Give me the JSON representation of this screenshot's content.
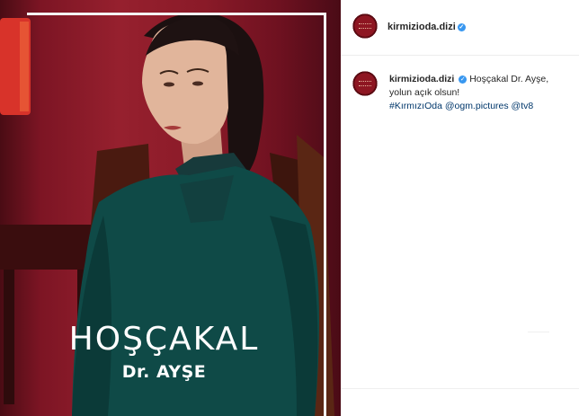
{
  "post": {
    "image_caption_title": "HOŞÇAKAL",
    "image_caption_subtitle": "Dr. AYŞE"
  },
  "header": {
    "username": "kirmizioda.dizi",
    "verified_icon": "✓"
  },
  "comment": {
    "username": "kirmizioda.dizi",
    "verified_icon": "✓",
    "message": "Hoşçakal Dr. Ayşe, yolun açık olsun!",
    "hashtags": "#KırmızıOda @ogm.pictures @tv8"
  },
  "colors": {
    "background_red": "#8a1a28",
    "sweater": "#0f4a47",
    "link": "#00376b",
    "verified": "#3897f0"
  }
}
